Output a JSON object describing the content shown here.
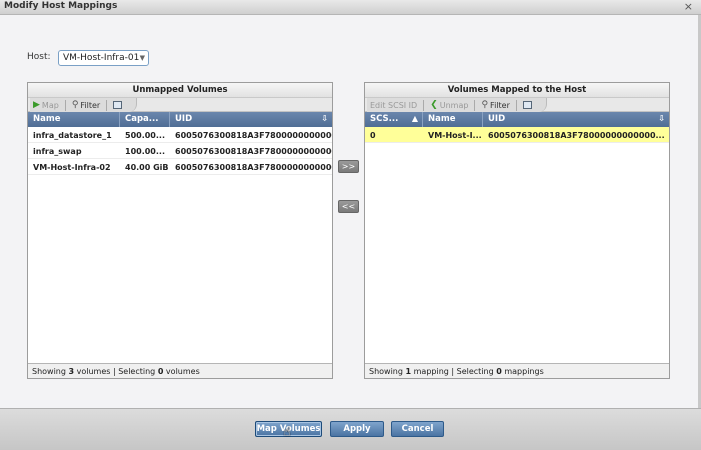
{
  "window": {
    "title": "Modify Host Mappings",
    "close_icon": "×"
  },
  "host": {
    "label": "Host:",
    "selected": "VM-Host-Infra-01"
  },
  "unmapped": {
    "title": "Unmapped Volumes",
    "toolbar": {
      "map": "Map",
      "filter": "Filter"
    },
    "columns": [
      "Name",
      "Capa...",
      "UID"
    ],
    "rows": [
      {
        "name": "infra_datastore_1",
        "capacity": "500.00...",
        "uid": "6005076300818A3F78000000000000..."
      },
      {
        "name": "infra_swap",
        "capacity": "100.00...",
        "uid": "6005076300818A3F78000000000000..."
      },
      {
        "name": "VM-Host-Infra-02",
        "capacity": "40.00 GiB",
        "uid": "6005076300818A3F78000000000000..."
      }
    ],
    "status": {
      "prefix": "Showing ",
      "count": "3",
      "mid": " volumes | Selecting ",
      "selected": "0",
      "suffix": " volumes"
    }
  },
  "mapped": {
    "title": "Volumes Mapped to the Host",
    "toolbar": {
      "edit": "Edit SCSI ID",
      "unmap": "Unmap",
      "filter": "Filter"
    },
    "columns": [
      "SCS...",
      "Name",
      "UID"
    ],
    "rows": [
      {
        "scsi": "0",
        "name": "VM-Host-I...",
        "uid": "6005076300818A3F78000000000000..."
      }
    ],
    "status": {
      "prefix": "Showing ",
      "count": "1",
      "mid": " mapping | Selecting ",
      "selected": "0",
      "suffix": " mappings"
    }
  },
  "transfer": {
    "right": ">>",
    "left": "<<"
  },
  "footer": {
    "map_volumes": "Map Volumes",
    "apply": "Apply",
    "cancel": "Cancel"
  }
}
